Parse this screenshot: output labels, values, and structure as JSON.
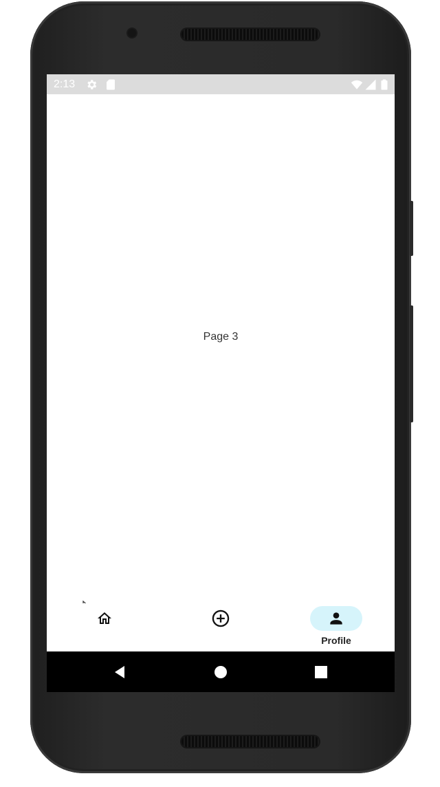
{
  "status_bar": {
    "time": "2:13",
    "icons": [
      "gear-icon",
      "sd-card-icon",
      "wifi-icon",
      "signal-icon",
      "battery-icon"
    ]
  },
  "main": {
    "page_label": "Page 3"
  },
  "bottom_nav": {
    "items": [
      {
        "icon": "home-icon",
        "label": "",
        "active": false
      },
      {
        "icon": "add-circle-icon",
        "label": "",
        "active": false
      },
      {
        "icon": "person-icon",
        "label": "Profile",
        "active": true
      }
    ],
    "active_color": "#d6f4fb"
  },
  "system_nav": {
    "buttons": [
      "back-icon",
      "home-circle-icon",
      "recents-square-icon"
    ]
  }
}
